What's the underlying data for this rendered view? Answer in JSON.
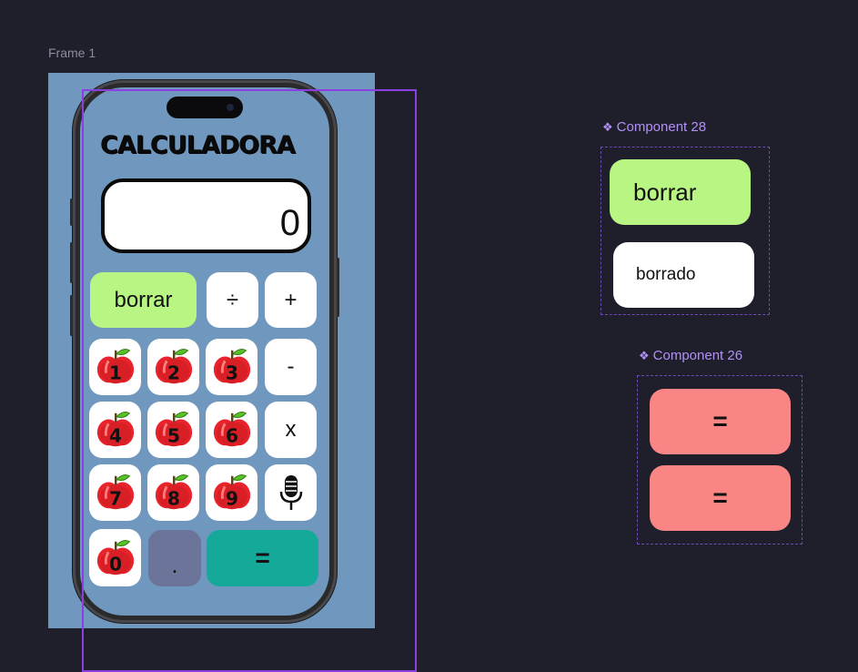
{
  "canvas": {
    "frame_label": "Frame 1"
  },
  "calculator": {
    "title": "CALCULADORA",
    "display": "0",
    "keys": {
      "borrar": "borrar",
      "divide": "÷",
      "plus": "+",
      "minus": "-",
      "times": "x",
      "dot": ".",
      "equals": "=",
      "digits": [
        "1",
        "2",
        "3",
        "4",
        "5",
        "6",
        "7",
        "8",
        "9",
        "0"
      ],
      "mic_icon": "microphone-icon"
    }
  },
  "components": {
    "component28": {
      "label": "Component 28",
      "variants": [
        "borrar",
        "borrado"
      ]
    },
    "component26": {
      "label": "Component 26",
      "variants": [
        "=",
        "="
      ]
    }
  },
  "colors": {
    "background": "#1e1f2b",
    "frame": "#7097bd",
    "borrar": "#b8f582",
    "equals": "#15a99a",
    "equals_variant": "#f98584",
    "dot": "#6d7499",
    "selection": "#8b3fe0",
    "component_label": "#b390f7"
  }
}
